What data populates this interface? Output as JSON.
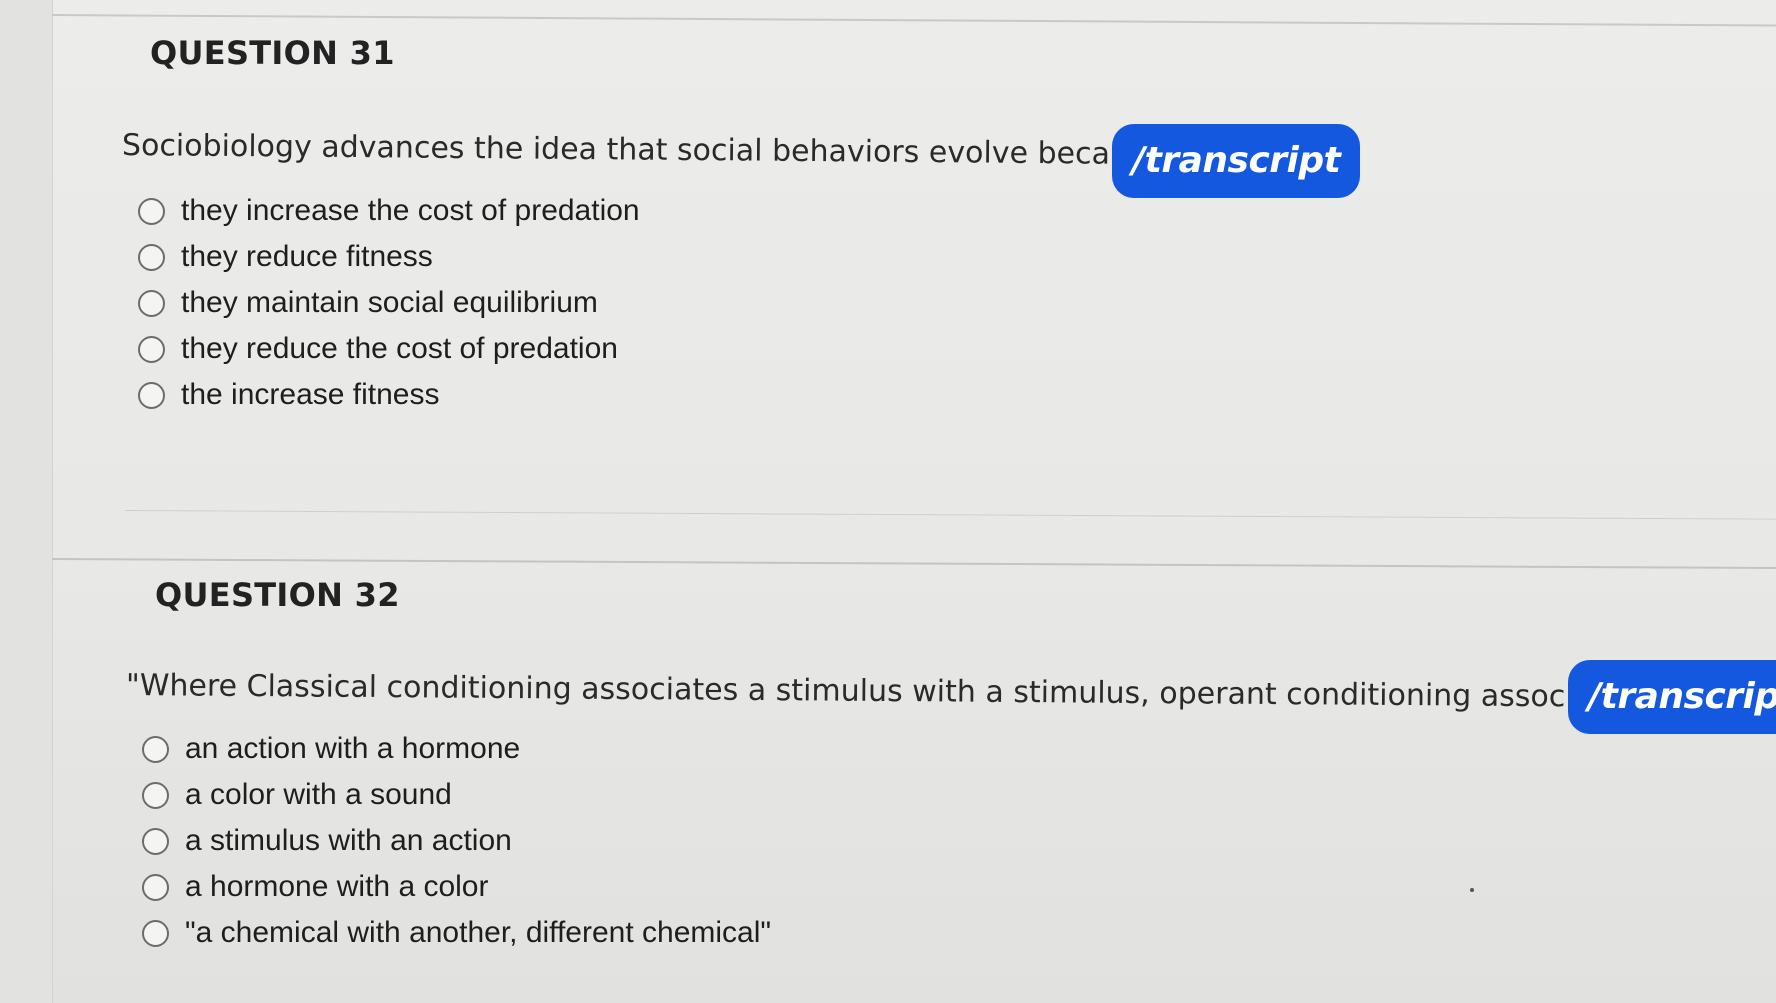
{
  "questions": [
    {
      "title": "QUESTION 31",
      "text": "Sociobiology advances the idea that social behaviors evolve because",
      "transcript_label": "/transcript",
      "options": [
        "they increase the cost of predation",
        "they reduce fitness",
        "they maintain social equilibrium",
        "they reduce the cost of predation",
        "the increase fitness"
      ]
    },
    {
      "title": "QUESTION 32",
      "text": "\"Where Classical conditioning associates a stimulus with a stimulus, operant conditioning associates\"",
      "transcript_label": "/transcript",
      "options": [
        "an action with a hormone",
        "a color with a sound",
        "a stimulus with an action",
        "a hormone with a color",
        "\"a chemical with another, different chemical\""
      ]
    }
  ],
  "colors": {
    "transcript_button": "#1458e0",
    "background": "#e8e8e6"
  },
  "icons": {
    "option_marker": "radio-unselected-icon"
  }
}
